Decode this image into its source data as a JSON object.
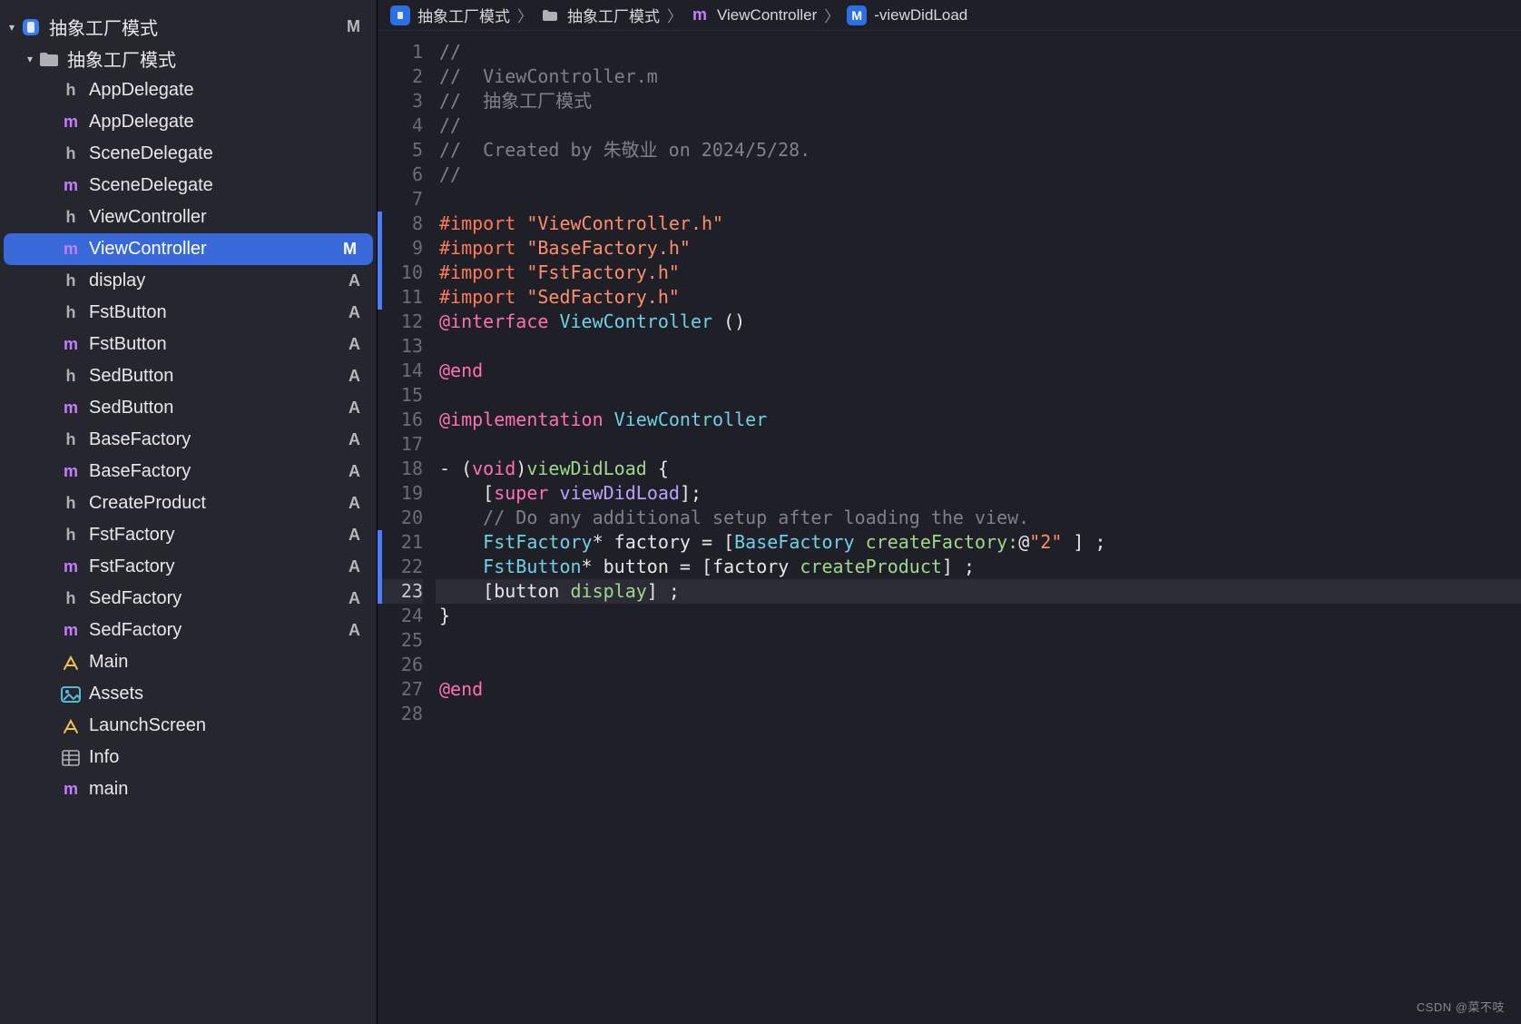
{
  "sidebar": {
    "root": {
      "name": "抽象工厂模式",
      "status": "M"
    },
    "group": {
      "name": "抽象工厂模式"
    },
    "files": [
      {
        "name": "AppDelegate",
        "kind": "h",
        "status": ""
      },
      {
        "name": "AppDelegate",
        "kind": "m",
        "status": ""
      },
      {
        "name": "SceneDelegate",
        "kind": "h",
        "status": ""
      },
      {
        "name": "SceneDelegate",
        "kind": "m",
        "status": ""
      },
      {
        "name": "ViewController",
        "kind": "h",
        "status": ""
      },
      {
        "name": "ViewController",
        "kind": "m",
        "status": "M",
        "selected": true
      },
      {
        "name": "display",
        "kind": "h",
        "status": "A"
      },
      {
        "name": "FstButton",
        "kind": "h",
        "status": "A"
      },
      {
        "name": "FstButton",
        "kind": "m",
        "status": "A"
      },
      {
        "name": "SedButton",
        "kind": "h",
        "status": "A"
      },
      {
        "name": "SedButton",
        "kind": "m",
        "status": "A"
      },
      {
        "name": "BaseFactory",
        "kind": "h",
        "status": "A"
      },
      {
        "name": "BaseFactory",
        "kind": "m",
        "status": "A"
      },
      {
        "name": "CreateProduct",
        "kind": "h",
        "status": "A"
      },
      {
        "name": "FstFactory",
        "kind": "h",
        "status": "A"
      },
      {
        "name": "FstFactory",
        "kind": "m",
        "status": "A"
      },
      {
        "name": "SedFactory",
        "kind": "h",
        "status": "A"
      },
      {
        "name": "SedFactory",
        "kind": "m",
        "status": "A"
      },
      {
        "name": "Main",
        "kind": "storyboard",
        "status": ""
      },
      {
        "name": "Assets",
        "kind": "assets",
        "status": ""
      },
      {
        "name": "LaunchScreen",
        "kind": "storyboard",
        "status": ""
      },
      {
        "name": "Info",
        "kind": "info",
        "status": ""
      },
      {
        "name": "main",
        "kind": "m",
        "status": ""
      }
    ]
  },
  "breadcrumb": {
    "project": "抽象工厂模式",
    "group": "抽象工厂模式",
    "file": "ViewController",
    "method": "-viewDidLoad"
  },
  "editor": {
    "current_line": 23,
    "lines": [
      {
        "n": 1,
        "tokens": [
          {
            "t": "//",
            "c": "comment"
          }
        ]
      },
      {
        "n": 2,
        "tokens": [
          {
            "t": "//  ViewController.m",
            "c": "comment"
          }
        ]
      },
      {
        "n": 3,
        "tokens": [
          {
            "t": "//  抽象工厂模式",
            "c": "comment"
          }
        ]
      },
      {
        "n": 4,
        "tokens": [
          {
            "t": "//",
            "c": "comment"
          }
        ]
      },
      {
        "n": 5,
        "tokens": [
          {
            "t": "//  Created by 朱敬业 on 2024/5/28.",
            "c": "comment"
          }
        ]
      },
      {
        "n": 6,
        "tokens": [
          {
            "t": "//",
            "c": "comment"
          }
        ]
      },
      {
        "n": 7,
        "tokens": []
      },
      {
        "n": 8,
        "tokens": [
          {
            "t": "#import ",
            "c": "macro"
          },
          {
            "t": "\"ViewController.h\"",
            "c": "string"
          }
        ]
      },
      {
        "n": 9,
        "tokens": [
          {
            "t": "#import ",
            "c": "macro"
          },
          {
            "t": "\"BaseFactory.h\"",
            "c": "string"
          }
        ]
      },
      {
        "n": 10,
        "tokens": [
          {
            "t": "#import ",
            "c": "macro"
          },
          {
            "t": "\"FstFactory.h\"",
            "c": "string"
          }
        ]
      },
      {
        "n": 11,
        "tokens": [
          {
            "t": "#import ",
            "c": "macro"
          },
          {
            "t": "\"SedFactory.h\"",
            "c": "string"
          }
        ]
      },
      {
        "n": 12,
        "tokens": [
          {
            "t": "@interface",
            "c": "at"
          },
          {
            "t": " ",
            "c": "plain"
          },
          {
            "t": "ViewController",
            "c": "class"
          },
          {
            "t": " ()",
            "c": "plain"
          }
        ]
      },
      {
        "n": 13,
        "tokens": []
      },
      {
        "n": 14,
        "tokens": [
          {
            "t": "@end",
            "c": "at"
          }
        ]
      },
      {
        "n": 15,
        "tokens": []
      },
      {
        "n": 16,
        "tokens": [
          {
            "t": "@implementation",
            "c": "at"
          },
          {
            "t": " ",
            "c": "plain"
          },
          {
            "t": "ViewController",
            "c": "class"
          }
        ]
      },
      {
        "n": 17,
        "tokens": []
      },
      {
        "n": 18,
        "tokens": [
          {
            "t": "- (",
            "c": "plain"
          },
          {
            "t": "void",
            "c": "keyword"
          },
          {
            "t": ")",
            "c": "plain"
          },
          {
            "t": "viewDidLoad",
            "c": "method"
          },
          {
            "t": " {",
            "c": "plain"
          }
        ]
      },
      {
        "n": 19,
        "tokens": [
          {
            "t": "    [",
            "c": "plain"
          },
          {
            "t": "super",
            "c": "keyword"
          },
          {
            "t": " ",
            "c": "plain"
          },
          {
            "t": "viewDidLoad",
            "c": "call"
          },
          {
            "t": "];",
            "c": "plain"
          }
        ]
      },
      {
        "n": 20,
        "tokens": [
          {
            "t": "    ",
            "c": "plain"
          },
          {
            "t": "// Do any additional setup after loading the view.",
            "c": "comment"
          }
        ]
      },
      {
        "n": 21,
        "tokens": [
          {
            "t": "    ",
            "c": "plain"
          },
          {
            "t": "FstFactory",
            "c": "class"
          },
          {
            "t": "* factory = [",
            "c": "plain"
          },
          {
            "t": "BaseFactory",
            "c": "class"
          },
          {
            "t": " ",
            "c": "plain"
          },
          {
            "t": "createFactory:",
            "c": "method"
          },
          {
            "t": "@",
            "c": "plain"
          },
          {
            "t": "\"2\"",
            "c": "string"
          },
          {
            "t": " ] ;",
            "c": "plain"
          }
        ]
      },
      {
        "n": 22,
        "tokens": [
          {
            "t": "    ",
            "c": "plain"
          },
          {
            "t": "FstButton",
            "c": "class"
          },
          {
            "t": "* button = [factory ",
            "c": "plain"
          },
          {
            "t": "createProduct",
            "c": "method"
          },
          {
            "t": "] ;",
            "c": "plain"
          }
        ]
      },
      {
        "n": 23,
        "tokens": [
          {
            "t": "    [button ",
            "c": "plain"
          },
          {
            "t": "display",
            "c": "method"
          },
          {
            "t": "] ;",
            "c": "plain"
          }
        ]
      },
      {
        "n": 24,
        "tokens": [
          {
            "t": "}",
            "c": "plain"
          }
        ]
      },
      {
        "n": 25,
        "tokens": []
      },
      {
        "n": 26,
        "tokens": []
      },
      {
        "n": 27,
        "tokens": [
          {
            "t": "@end",
            "c": "at"
          }
        ]
      },
      {
        "n": 28,
        "tokens": []
      }
    ],
    "change_bars": [
      {
        "from": 8,
        "to": 11
      },
      {
        "from": 21,
        "to": 23
      }
    ]
  },
  "watermark": "CSDN @菜不吱"
}
